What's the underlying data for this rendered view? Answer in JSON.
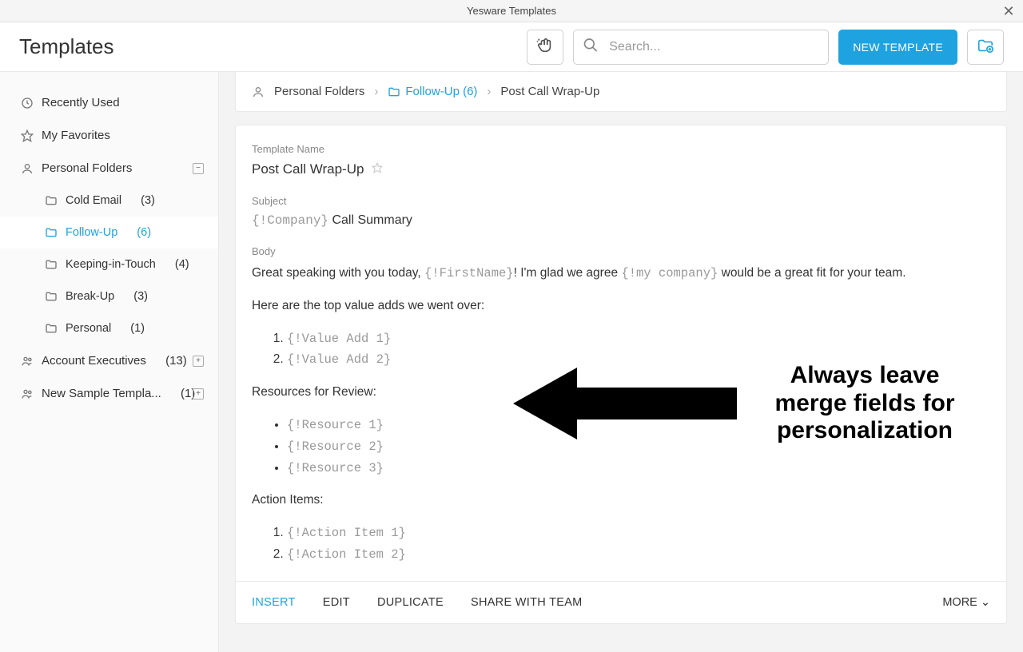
{
  "window": {
    "title": "Yesware Templates"
  },
  "header": {
    "title": "Templates",
    "search_placeholder": "Search...",
    "new_template": "NEW TEMPLATE"
  },
  "sidebar": {
    "recently_used": "Recently Used",
    "my_favorites": "My Favorites",
    "personal_folders": "Personal Folders",
    "folders": [
      {
        "label": "Cold Email",
        "count": "(3)"
      },
      {
        "label": "Follow-Up",
        "count": "(6)"
      },
      {
        "label": "Keeping-in-Touch",
        "count": "(4)"
      },
      {
        "label": "Break-Up",
        "count": "(3)"
      },
      {
        "label": "Personal",
        "count": "(1)"
      }
    ],
    "account_executives": {
      "label": "Account Executives",
      "count": "(13)"
    },
    "new_sample": {
      "label": "New Sample Templa...",
      "count": "(1)"
    }
  },
  "breadcrumb": {
    "root": "Personal Folders",
    "folder": "Follow-Up (6)",
    "current": "Post Call Wrap-Up"
  },
  "template": {
    "name_label": "Template Name",
    "name": "Post Call Wrap-Up",
    "subject_label": "Subject",
    "subject_merge": "{!Company}",
    "subject_text": " Call Summary",
    "body_label": "Body",
    "body": {
      "line1_a": "Great speaking with you today, ",
      "line1_m1": "{!FirstName}",
      "line1_b": "! I'm glad we agree ",
      "line1_m2": "{!my company}",
      "line1_c": " would be a great fit for your team.",
      "line2": "Here are the top value adds we went over:",
      "value_adds": [
        "{!Value Add 1}",
        "{!Value Add 2}"
      ],
      "resources_label": "Resources for Review:",
      "resources": [
        "{!Resource 1}",
        "{!Resource 2}",
        "{!Resource 3}"
      ],
      "action_items_label": "Action Items:",
      "action_items": [
        "{!Action Item 1}",
        "{!Action Item 2}"
      ]
    }
  },
  "actions": {
    "insert": "INSERT",
    "edit": "EDIT",
    "duplicate": "DUPLICATE",
    "share": "SHARE WITH TEAM",
    "more": "MORE"
  },
  "annotation": {
    "text": "Always leave merge fields for personalization"
  }
}
